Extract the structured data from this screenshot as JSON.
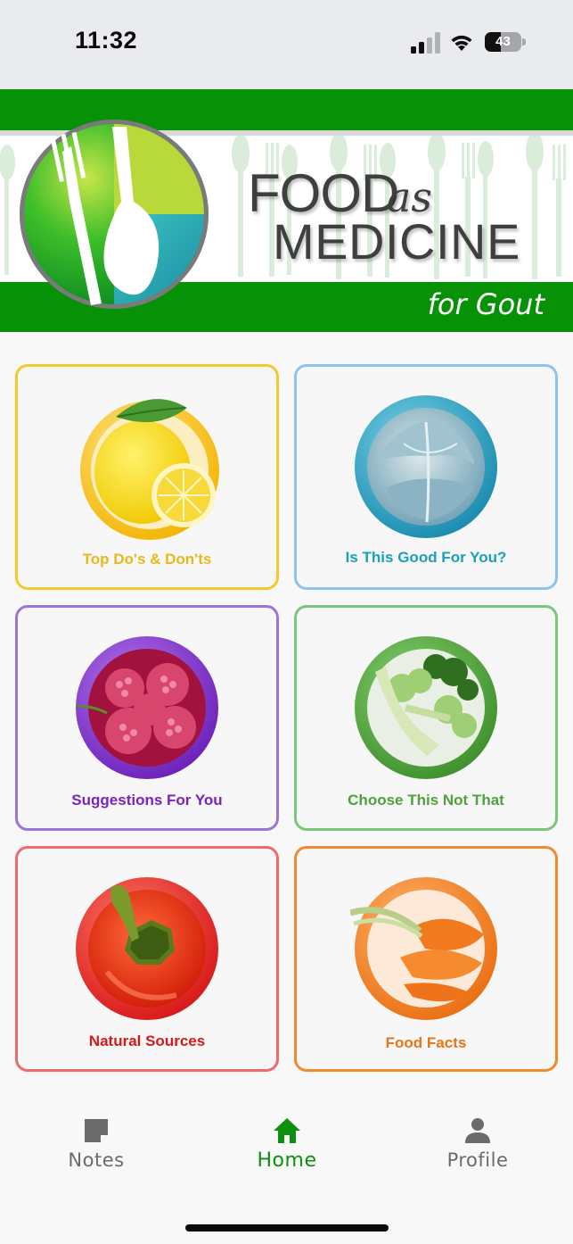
{
  "status_bar": {
    "time": "11:32",
    "battery_level": "43",
    "battery_fraction": 0.43
  },
  "header": {
    "brand_line1": "FOOD",
    "brand_as": "as",
    "brand_line2": "MEDICINE",
    "brand_subtitle": "for Gout",
    "brand_color": "#079107"
  },
  "cards": [
    {
      "label": "Top Do's & Don'ts",
      "color": "#f6c92b",
      "text_color": "#e9b81a",
      "icon": "lemon-icon"
    },
    {
      "label": "Is This Good For You?",
      "color": "#8fc3ef",
      "text_color": "#1aa0b8",
      "icon": "cabbage-icon"
    },
    {
      "label": "Suggestions For You",
      "color": "#9c74d6",
      "text_color": "#7a22bd",
      "icon": "raspberry-icon"
    },
    {
      "label": "Choose This Not That",
      "color": "#7ac67a",
      "text_color": "#4ea13c",
      "icon": "broccoli-icon"
    },
    {
      "label": "Natural Sources",
      "color": "#ee6b6b",
      "text_color": "#d81919",
      "icon": "pepper-icon"
    },
    {
      "label": "Food Facts",
      "color": "#f08a2e",
      "text_color": "#e4751a",
      "icon": "carrot-icon"
    }
  ],
  "nav": {
    "notes": "Notes",
    "home": "Home",
    "profile": "Profile",
    "active": "home",
    "active_color": "#0f8f0f",
    "inactive_color": "#6b6b6b"
  }
}
